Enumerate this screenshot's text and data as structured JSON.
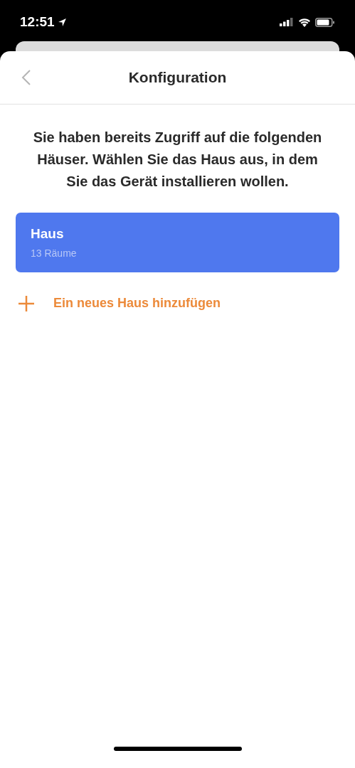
{
  "status_bar": {
    "time": "12:51"
  },
  "header": {
    "title": "Konfiguration"
  },
  "intro": "Sie haben bereits Zugriff auf die folgenden Häuser. Wählen Sie das Haus aus, in dem Sie das Gerät installieren wollen.",
  "houses": [
    {
      "name": "Haus",
      "rooms": "13 Räume",
      "selected": true
    }
  ],
  "add_house": {
    "label": "Ein neues Haus hinzufügen"
  }
}
